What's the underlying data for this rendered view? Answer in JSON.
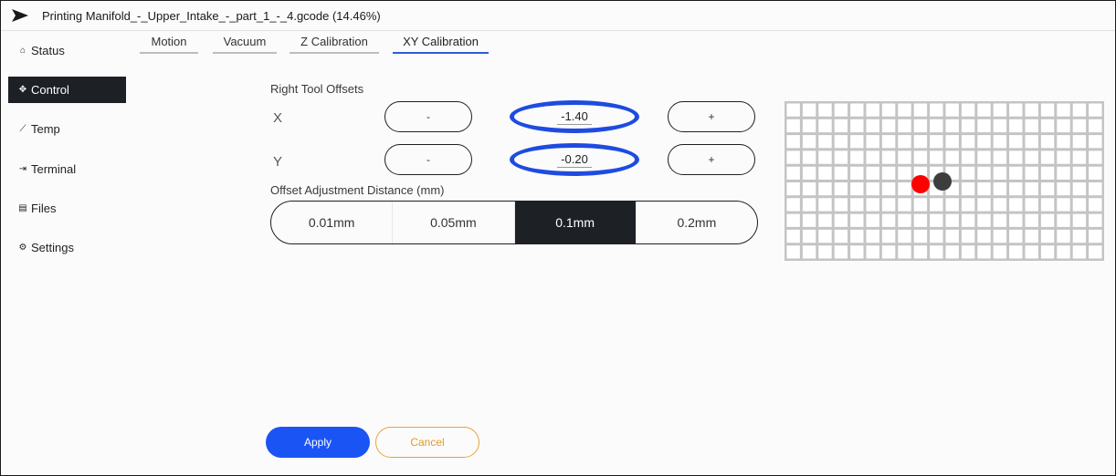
{
  "window": {
    "title": "Printing Manifold_-_Upper_Intake_-_part_1_-_4.gcode (14.46%)",
    "logo_icon": "arrow-logo-icon"
  },
  "sidebar": {
    "items": [
      {
        "label": "Status",
        "icon": "home-icon",
        "glyph": "⌂",
        "active": false
      },
      {
        "label": "Control",
        "icon": "move-arrows-icon",
        "glyph": "✥",
        "active": true
      },
      {
        "label": "Temp",
        "icon": "trend-line-icon",
        "glyph": "⟋",
        "active": false
      },
      {
        "label": "Terminal",
        "icon": "terminal-arrow-icon",
        "glyph": "⇥",
        "active": false
      },
      {
        "label": "Files",
        "icon": "file-icon",
        "glyph": "▤",
        "active": false
      },
      {
        "label": "Settings",
        "icon": "gear-icon",
        "glyph": "⚙",
        "active": false
      }
    ]
  },
  "tabs": [
    {
      "label": "Motion",
      "active": false
    },
    {
      "label": "Vacuum",
      "active": false
    },
    {
      "label": "Z Calibration",
      "active": false
    },
    {
      "label": "XY Calibration",
      "active": true
    }
  ],
  "offsets": {
    "section_label": "Right Tool Offsets",
    "x": {
      "label": "X",
      "minus": "-",
      "value": "-1.40",
      "plus": "+"
    },
    "y": {
      "label": "Y",
      "minus": "-",
      "value": "-0.20",
      "plus": "+"
    }
  },
  "distance": {
    "label": "Offset Adjustment Distance (mm)",
    "options": [
      "0.01mm",
      "0.05mm",
      "0.1mm",
      "0.2mm"
    ],
    "selected": "0.1mm"
  },
  "preview": {
    "grid_color": "#c4c4c4",
    "reference_dot_color": "#ff0000",
    "tool_dot_color": "#3d3d3d"
  },
  "actions": {
    "apply_label": "Apply",
    "cancel_label": "Cancel"
  },
  "colors": {
    "accent": "#1b54f5",
    "highlight_ring": "#1e4be0",
    "active_dark": "#1d2126",
    "cancel_orange": "#e39a25"
  }
}
